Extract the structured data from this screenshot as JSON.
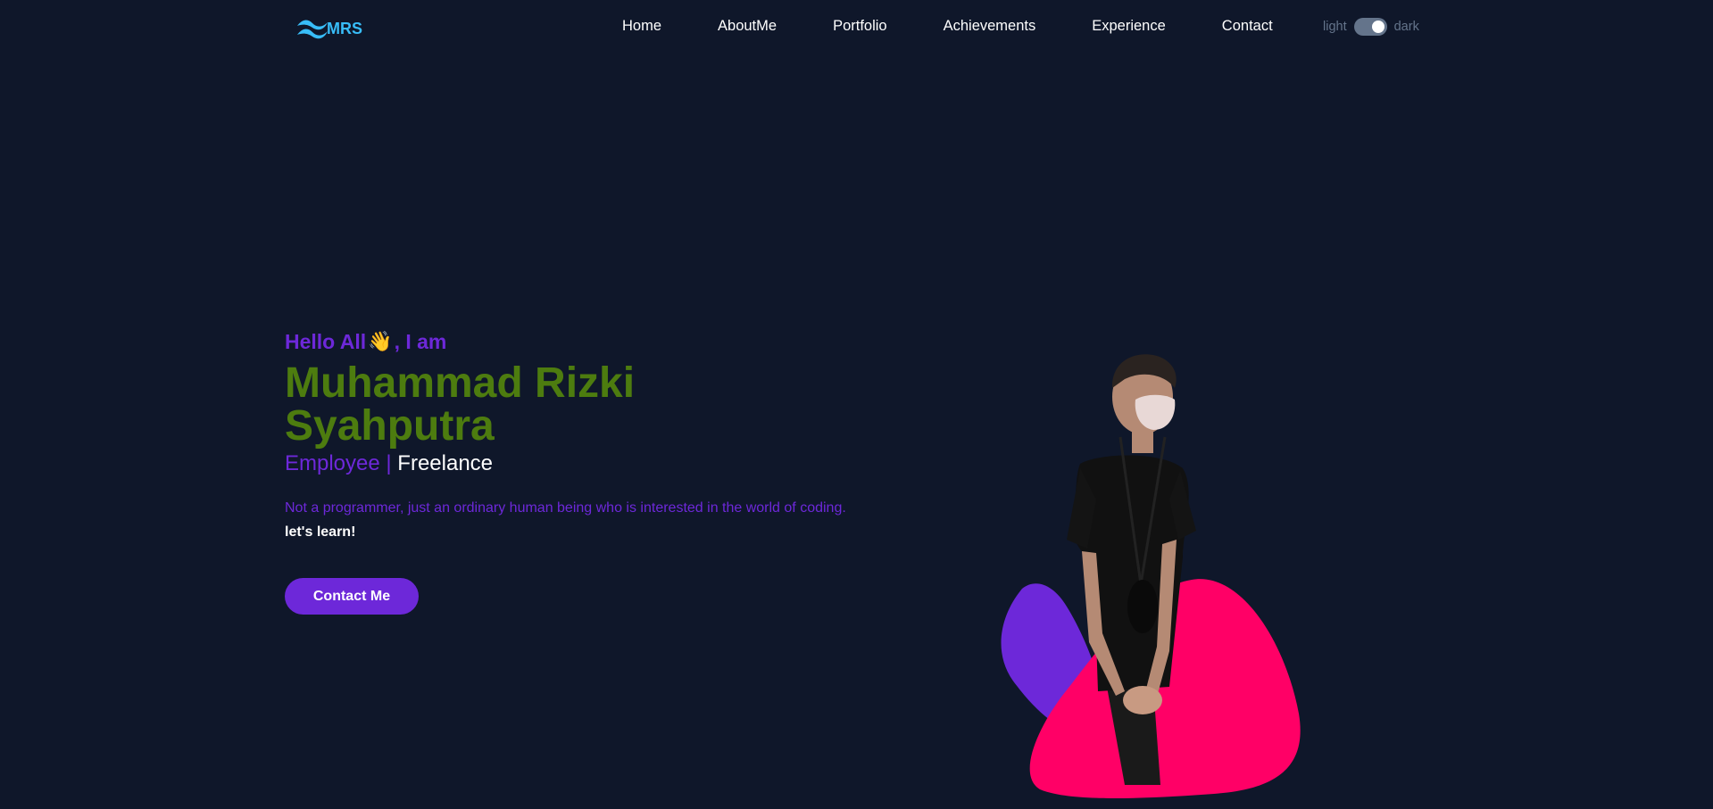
{
  "logo": {
    "text": "MRS",
    "icon": "wave-logo-icon"
  },
  "nav": [
    "Home",
    "AboutMe",
    "Portfolio",
    "Achievements",
    "Experience",
    "Contact"
  ],
  "theme": {
    "light_label": "light",
    "dark_label": "dark",
    "mode": "dark"
  },
  "hero": {
    "greeting_prefix": "Hello All",
    "greeting_emoji": "👋",
    "greeting_suffix": ", I am",
    "name": "Muhammad Rizki Syahputra",
    "role_primary": "Employee |",
    "role_secondary": "Freelance",
    "description": "Not a programmer, just an ordinary human being who is interested in the world of coding.",
    "tagline": "let's learn!",
    "cta_label": "Contact Me"
  },
  "colors": {
    "background": "#0f172a",
    "accent_purple": "#6d28d9",
    "name_green": "#4d7c0f",
    "logo_blue": "#38bdf8",
    "blob_pink": "#ff0066",
    "toggle_gray": "#64748b"
  }
}
